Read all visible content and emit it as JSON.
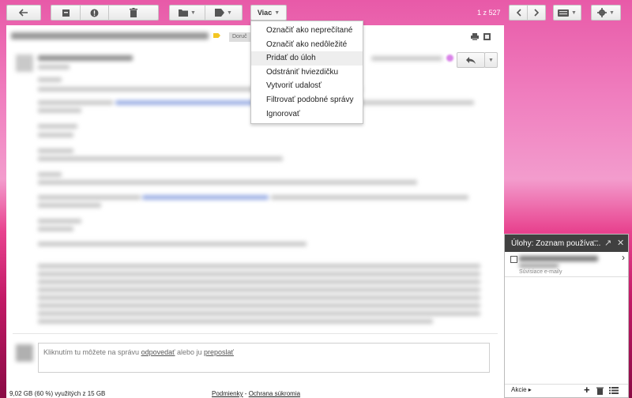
{
  "toolbar": {
    "back_icon": "arrow-left-icon",
    "archive_icon": "archive-icon",
    "spam_icon": "report-spam-icon",
    "delete_icon": "trash-icon",
    "folder_icon": "folder-icon",
    "label_icon": "label-icon",
    "more_label": "Viac",
    "pagination": "1 z 527",
    "settings_icon": "gear-icon",
    "keyboard_icon": "keyboard-icon"
  },
  "more_menu": {
    "items": [
      "Označiť ako neprečítané",
      "Označiť ako nedôležité",
      "Pridať do úloh",
      "Odstrániť hviezdičku",
      "Vytvoriť udalosť",
      "Filtrovať podobné správy",
      "Ignorovať"
    ],
    "highlighted_index": 2
  },
  "email": {
    "label_tag": "Doruč",
    "reply_box_text_before": "Kliknutím tu môžete na správu ",
    "reply_link": "odpovedať",
    "reply_middle": " alebo ju ",
    "forward_link": "preposlať"
  },
  "footer": {
    "storage": "9,02 GB (60 %) využitých z 15 GB",
    "terms": "Podmienky",
    "separator": " - ",
    "privacy": "Ochrana súkromia"
  },
  "tasks_panel": {
    "title": "Úlohy: Zoznam používa...",
    "related": "Súvisiace e-maily",
    "actions_label": "Akcie ▸"
  },
  "colors": {
    "accent": "#4d90fe",
    "panel_header": "#404040"
  }
}
